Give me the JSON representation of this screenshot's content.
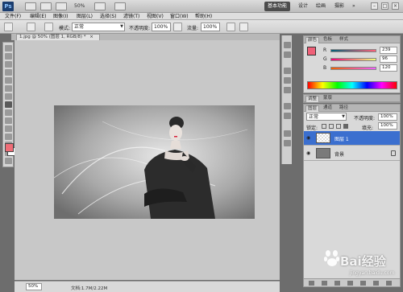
{
  "titlebar": {
    "app_logo": "Ps",
    "zoom": "50%",
    "workspaces": [
      "基本功能",
      "设计",
      "绘画",
      "摄影"
    ],
    "more": "»",
    "window_controls": [
      "–",
      "□",
      "×"
    ]
  },
  "menubar": {
    "items": [
      "文件(F)",
      "编辑(E)",
      "图像(I)",
      "图层(L)",
      "选择(S)",
      "滤镜(T)",
      "视图(V)",
      "窗口(W)",
      "帮助(H)"
    ]
  },
  "options": {
    "mode_label": "模式:",
    "mode_value": "正常",
    "opacity_label": "不透明度:",
    "opacity_value": "100%",
    "flow_label": "流量:",
    "flow_value": "100%"
  },
  "document": {
    "tab_label": "1.jpg @ 50% (图层 1, RGB/8) *",
    "tab_close": "×"
  },
  "status": {
    "zoom": "50%",
    "doc_info": "文档:1.7M/2.22M"
  },
  "color_panel": {
    "tabs": [
      "颜色",
      "色板",
      "样式"
    ],
    "channels": [
      {
        "label": "R",
        "value": "239",
        "fraction": 0.937
      },
      {
        "label": "G",
        "value": "96",
        "fraction": 0.376
      },
      {
        "label": "B",
        "value": "120",
        "fraction": 0.471
      }
    ],
    "foreground_color": "#ef6078"
  },
  "adjust_panel": {
    "tabs": [
      "调整",
      "蒙版"
    ]
  },
  "layers_panel": {
    "tabs": [
      "图层",
      "通道",
      "路径"
    ],
    "blend_mode": "正常",
    "opacity_label": "不透明度:",
    "opacity_value": "100%",
    "lock_label": "锁定:",
    "fill_label": "填充:",
    "fill_value": "100%",
    "layers": [
      {
        "name": "图层 1",
        "selected": true
      },
      {
        "name": "背景",
        "selected": false
      }
    ]
  },
  "watermark": {
    "brand": "Bai经验",
    "url": "jingyan.baidu.com"
  },
  "colors": {
    "selected_layer": "#3b6fcf",
    "foreground": "#ef6d77"
  }
}
